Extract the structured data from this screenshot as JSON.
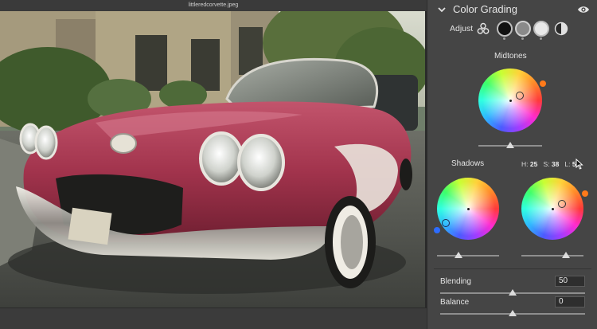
{
  "document": {
    "filename": "littleredcorvette.jpeg"
  },
  "panel": {
    "title": "Color Grading",
    "adjust_label": "Adjust",
    "midtones_label": "Midtones",
    "shadows_label": "Shadows",
    "shadows_readout": {
      "h_label": "H:",
      "h_value": "25",
      "s_label": "S:",
      "s_value": "38",
      "l_label": "L:",
      "l_value": "5"
    },
    "blending_label": "Blending",
    "blending_value": "50",
    "balance_label": "Balance",
    "balance_value": "0",
    "sliders": {
      "midtones_luminance": 0.5,
      "shadows_luminance": 0.35,
      "highlights_luminance": 0.72,
      "blending": 0.5,
      "balance": 0.5
    },
    "colors": {
      "accent_orange": "#ff7a1a",
      "accent_blue": "#2d6cff"
    },
    "icons": [
      "chevron-down-icon",
      "eye-icon",
      "three-circles-icon",
      "shadows-circle-icon",
      "midtones-circle-icon",
      "highlights-circle-icon",
      "global-half-circle-icon",
      "cursor-icon"
    ]
  }
}
